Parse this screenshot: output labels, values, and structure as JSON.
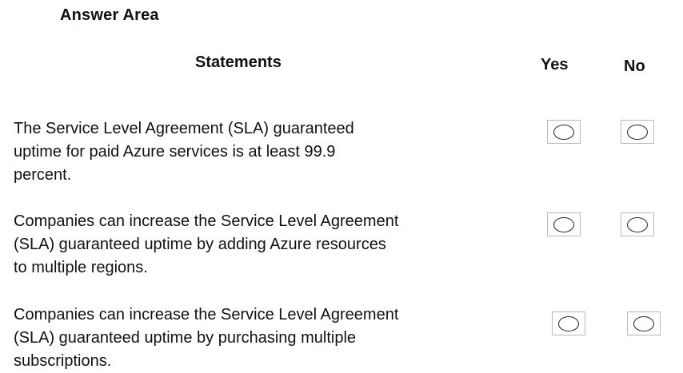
{
  "answer_area": {
    "title": "Answer Area"
  },
  "headers": {
    "statements": "Statements",
    "yes": "Yes",
    "no": "No"
  },
  "statements": [
    {
      "text_line1": "The Service Level Agreement (SLA) guaranteed",
      "text_line2": "uptime for paid Azure services is at least 99.9",
      "text_line3": "percent."
    },
    {
      "text_line1": "Companies can increase the Service Level Agreement",
      "text_line2": "(SLA) guaranteed uptime by adding Azure resources",
      "text_line3": "to multiple regions."
    },
    {
      "text_line1": "Companies can increase the Service Level Agreement",
      "text_line2": "(SLA) guaranteed uptime by purchasing multiple",
      "text_line3": "subscriptions."
    }
  ],
  "selections": {
    "statement_1": "none",
    "statement_2": "none",
    "statement_3": "none"
  }
}
